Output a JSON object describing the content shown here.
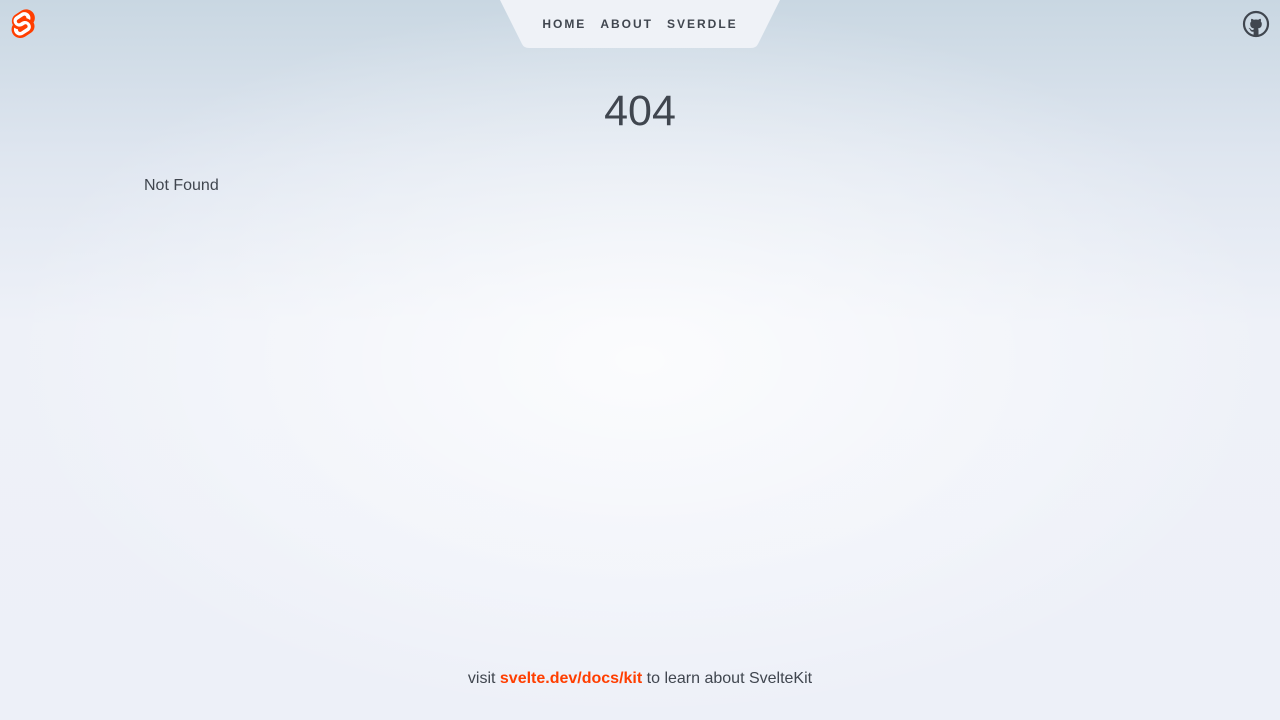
{
  "header": {
    "logo_icon": "svelte-logo-icon",
    "github_icon": "github-icon",
    "nav": {
      "items": [
        {
          "label": "Home"
        },
        {
          "label": "About"
        },
        {
          "label": "Sverdle"
        }
      ]
    }
  },
  "main": {
    "status": "404",
    "message": "Not Found"
  },
  "footer": {
    "prefix": "visit",
    "link_text": "svelte.dev/docs/kit",
    "suffix": "to learn about SvelteKit"
  },
  "colors": {
    "accent": "#ff3e00",
    "text": "#40464f",
    "nav_bg": "#eff2f7"
  }
}
